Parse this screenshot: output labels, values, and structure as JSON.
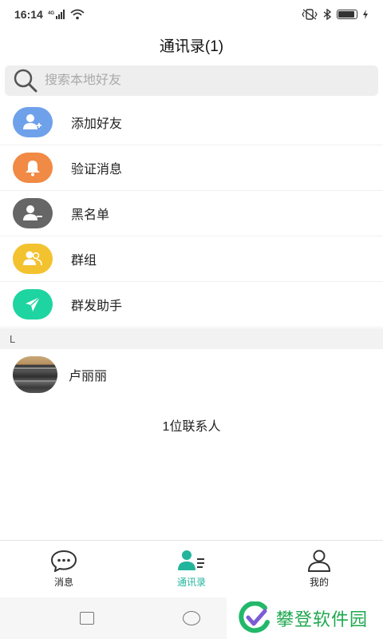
{
  "status": {
    "time": "16:14",
    "network": "4G"
  },
  "header": {
    "title": "通讯录(1)"
  },
  "search": {
    "placeholder": "搜索本地好友"
  },
  "menu": {
    "items": [
      {
        "label": "添加好友",
        "icon": "add-user-icon",
        "color": "#6fa1ea"
      },
      {
        "label": "验证消息",
        "icon": "bell-icon",
        "color": "#f08a45"
      },
      {
        "label": "黑名单",
        "icon": "remove-user-icon",
        "color": "#666666"
      },
      {
        "label": "群组",
        "icon": "group-icon",
        "color": "#f3c22f"
      },
      {
        "label": "群发助手",
        "icon": "send-icon",
        "color": "#1ed4a0"
      }
    ]
  },
  "section": {
    "letter": "L"
  },
  "contacts": [
    {
      "name": "卢丽丽"
    }
  ],
  "contact_count": "1位联系人",
  "tabbar": {
    "tabs": [
      {
        "label": "消息",
        "icon": "chat-bubble-icon",
        "active": false
      },
      {
        "label": "通讯录",
        "icon": "contacts-icon",
        "active": true
      },
      {
        "label": "我的",
        "icon": "profile-icon",
        "active": false
      }
    ],
    "active_color": "#22b59c"
  },
  "watermark": {
    "text": "攀登软件园"
  }
}
